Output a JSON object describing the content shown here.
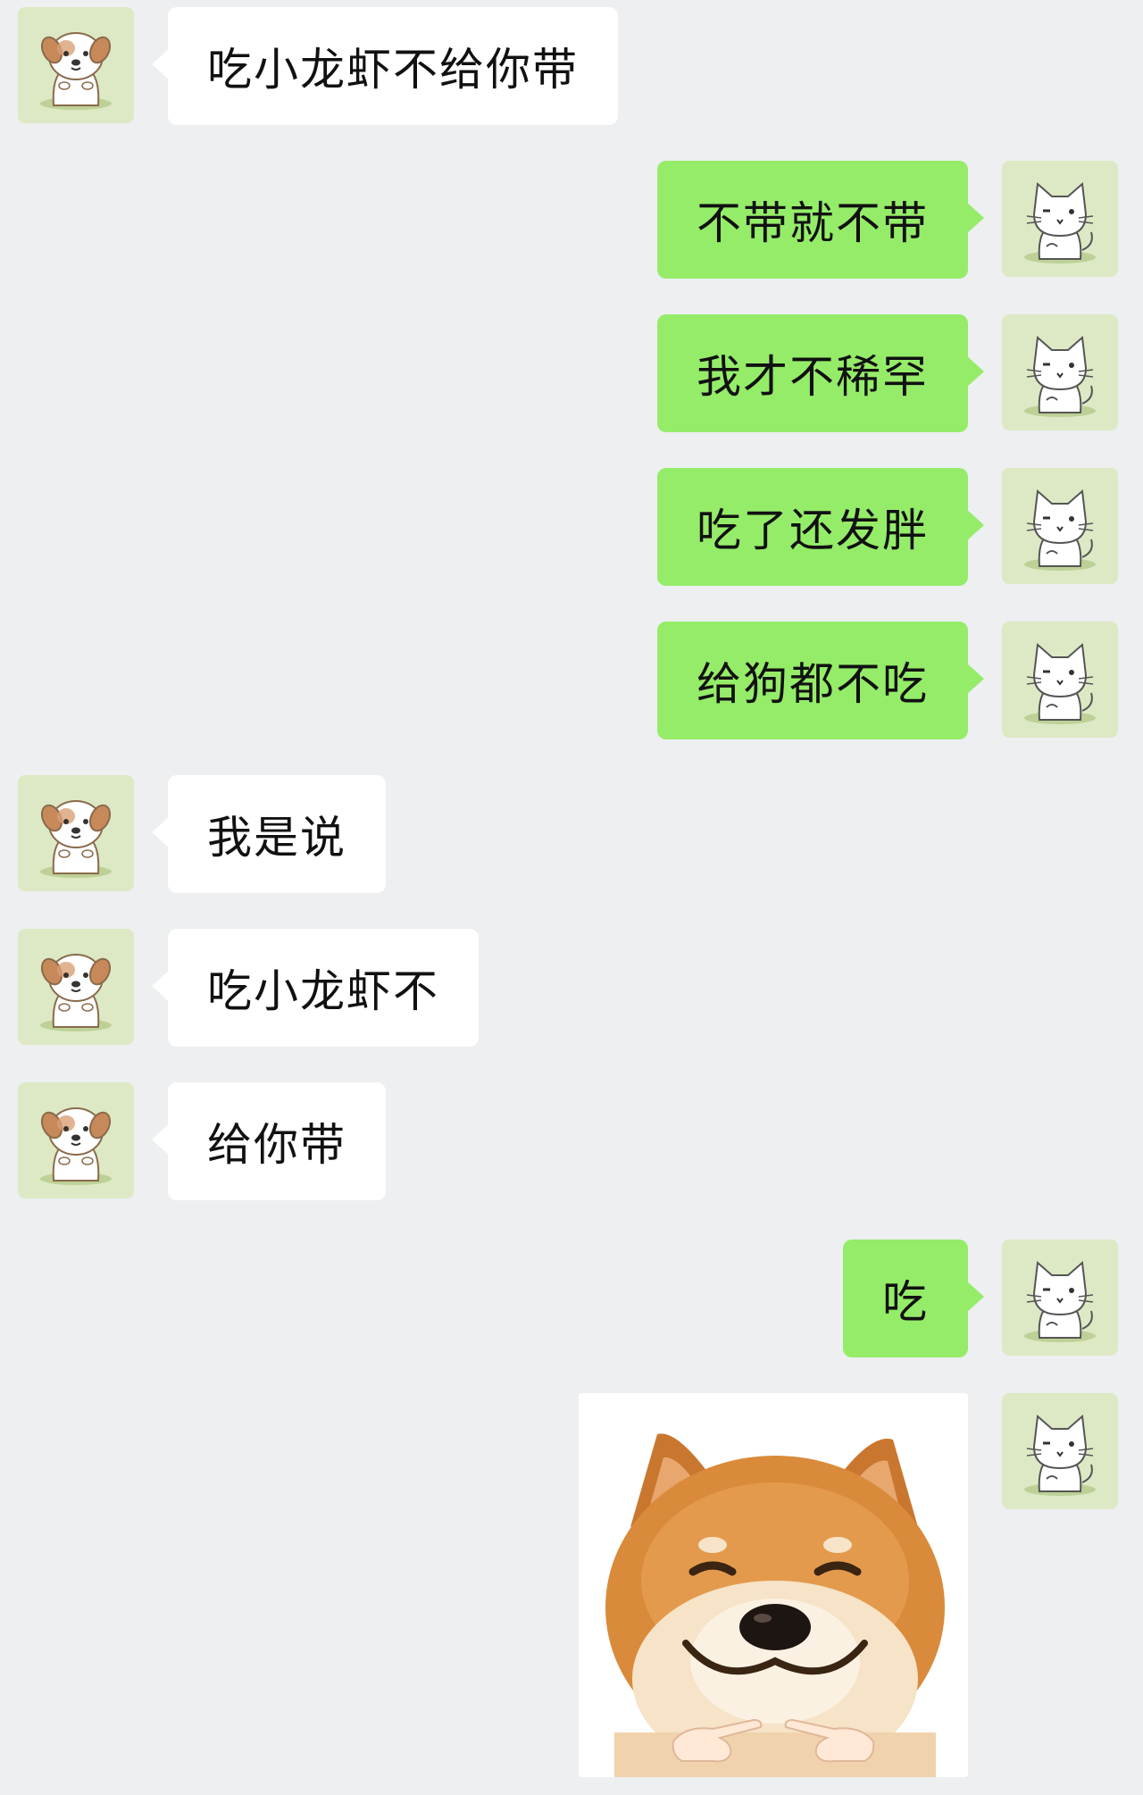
{
  "chat": {
    "messages": [
      {
        "side": "left",
        "sender": "dog",
        "text": "吃小龙虾不给你带"
      },
      {
        "side": "right",
        "sender": "cat",
        "text": "不带就不带"
      },
      {
        "side": "right",
        "sender": "cat",
        "text": "我才不稀罕"
      },
      {
        "side": "right",
        "sender": "cat",
        "text": "吃了还发胖"
      },
      {
        "side": "right",
        "sender": "cat",
        "text": "给狗都不吃"
      },
      {
        "side": "left",
        "sender": "dog",
        "text": "我是说"
      },
      {
        "side": "left",
        "sender": "dog",
        "text": "吃小龙虾不"
      },
      {
        "side": "left",
        "sender": "dog",
        "text": "给你带"
      },
      {
        "side": "right",
        "sender": "cat",
        "text": "吃"
      },
      {
        "side": "right",
        "sender": "cat",
        "type": "sticker",
        "sticker": "shiba-inu-pointing-sticker"
      }
    ]
  },
  "avatars": {
    "dog": "cartoon-dog-avatar",
    "cat": "cartoon-cat-avatar"
  },
  "colors": {
    "background": "#edeff0",
    "self_bubble": "#95ec69",
    "other_bubble": "#ffffff",
    "avatar_bg": "#dde9c4"
  }
}
